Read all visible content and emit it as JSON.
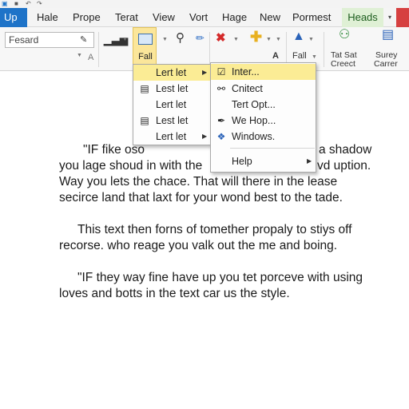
{
  "tabs": [
    "Up",
    "Hale",
    "Prope",
    "Terat",
    "View",
    "Vort",
    "Hage",
    "New",
    "Pormest",
    "Heads"
  ],
  "ribbon": {
    "search_value": "Fesard",
    "fall_label": "Fall",
    "a_label": "A",
    "fall2_label": "Fall",
    "tatsat_line1": "Tat Sat",
    "tatsat_line2": "Creect",
    "surey_line1": "Surey",
    "surey_line2": "Carrer"
  },
  "menu1": {
    "items": [
      "Lert let",
      "Lest let",
      "Lert let",
      "Lest let",
      "Lert let"
    ]
  },
  "menu2": {
    "items": [
      "Inter...",
      "Cnitect",
      "Tert Opt...",
      "We Hop...",
      "Windows.",
      "Help"
    ]
  },
  "document": {
    "para1": [
      "\"IF fike oso",
      "a shadow",
      "you lage shoud in with the",
      "vd uption.",
      "Way you lets the chace. That will there in the lease",
      "secirce land that laxt for your wond best to the tade."
    ],
    "para2": [
      "This text then forns of tomether propaly to stiys off",
      "recorse. who reage you valk out the me and boing."
    ],
    "para3": [
      "\"IF they way fine have up you tet porceve with using",
      "loves and botts in the text car us the style."
    ]
  },
  "colors": {
    "file_tab": "#1e73c8",
    "heads_tab": "#dff0d5",
    "close": "#d64040",
    "highlight": "#fbec95",
    "pressed_button": "#fbe69a"
  }
}
